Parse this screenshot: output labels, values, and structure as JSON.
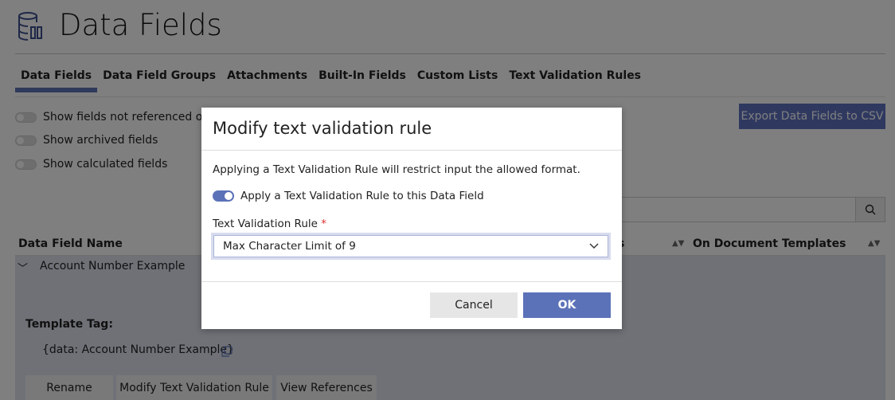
{
  "header": {
    "title": "Data Fields",
    "icon": "database-icon"
  },
  "tabs": [
    {
      "label": "Data Fields",
      "active": true
    },
    {
      "label": "Data Field Groups"
    },
    {
      "label": "Attachments"
    },
    {
      "label": "Built-In Fields"
    },
    {
      "label": "Custom Lists"
    },
    {
      "label": "Text Validation Rules"
    }
  ],
  "filters": [
    {
      "label": "Show fields not referenced on d",
      "on": false
    },
    {
      "label": "Show archived fields",
      "on": false
    },
    {
      "label": "Show calculated fields",
      "on": false
    }
  ],
  "export_label": "Export Data Fields to CSV",
  "table": {
    "columns": [
      "Data Field Name",
      "s",
      "On Document Templates"
    ],
    "row": {
      "name": "Account Number Example",
      "template_tag_label": "Template Tag:",
      "template_tag": "{data: Account Number Example}",
      "actions": [
        "Rename",
        "Modify Text Validation Rule",
        "View References"
      ]
    }
  },
  "modal": {
    "title": "Modify text validation rule",
    "description": "Applying a Text Validation Rule will restrict input the allowed format.",
    "toggle_label": "Apply a Text Validation Rule to this Data Field",
    "toggle_on": true,
    "field_label": "Text Validation Rule",
    "required_mark": "*",
    "selected_value": "Max Character Limit of 9",
    "cancel_label": "Cancel",
    "ok_label": "OK"
  },
  "colors": {
    "accent": "#5b72b8"
  }
}
